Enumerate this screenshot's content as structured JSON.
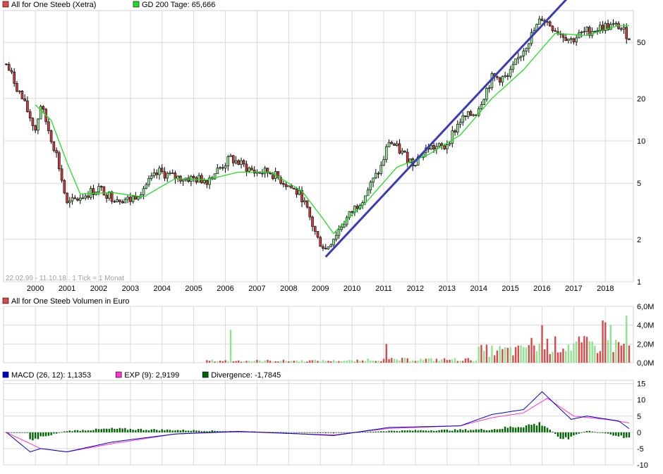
{
  "colors": {
    "up": "#8fe28f",
    "down": "#c83c3c",
    "ma": "#22dd22",
    "trend": "#3b3bb5",
    "vol_up": "#8fe28f",
    "vol_down": "#d94a4a",
    "macd": "#0000cc",
    "exp": "#ff33cc",
    "divergence": "#006400",
    "grid": "#d9d9d9"
  },
  "price_panel": {
    "legend": [
      {
        "name": "All for One Steeb (Xetra)",
        "color": "#d94a4a",
        "icon": "red-square-icon"
      },
      {
        "name": "GD 200 Tage: 65,666",
        "color": "#22dd22",
        "icon": "green-square-icon"
      }
    ],
    "footnote": "22.02.99 - 11.10.18 . 1 Tick = 1 Monat",
    "years": [
      "2000",
      "2001",
      "2002",
      "2003",
      "2004",
      "2005",
      "2006",
      "2007",
      "2008",
      "2009",
      "2010",
      "2011",
      "2012",
      "2013",
      "2014",
      "2015",
      "2016",
      "2017",
      "2018"
    ]
  },
  "volume_panel": {
    "legend": [
      {
        "name": "All for One Steeb Volumen in Euro",
        "color": "#d94a4a",
        "icon": "red-square-icon"
      }
    ]
  },
  "macd_panel": {
    "legend": [
      {
        "name": "MACD (26, 12): 1,1353",
        "color": "#0000cc",
        "icon": "blue-square-icon"
      },
      {
        "name": "EXP (9): 2,9199",
        "color": "#ff33cc",
        "icon": "magenta-square-icon"
      },
      {
        "name": "Divergence: -1,7845",
        "color": "#006400",
        "icon": "darkgreen-square-icon"
      }
    ]
  },
  "chart_data": [
    {
      "type": "candlestick",
      "title": "All for One Steeb (Xetra)",
      "scale": "log",
      "x_range": [
        "1999-02",
        "2018-10"
      ],
      "y_ticks": [
        1,
        2,
        5,
        10,
        20,
        50
      ],
      "y_tick_labels": [
        "1",
        "2",
        "5",
        "10",
        "20",
        "50"
      ],
      "ylim": [
        1,
        100
      ],
      "close_anchors": [
        {
          "x": "1999-02",
          "close": 35
        },
        {
          "x": "1999-07",
          "close": 22
        },
        {
          "x": "2000-01",
          "close": 12
        },
        {
          "x": "2000-03",
          "close": 18
        },
        {
          "x": "2000-09",
          "close": 8
        },
        {
          "x": "2001-01",
          "close": 3.5
        },
        {
          "x": "2001-06",
          "close": 4.0
        },
        {
          "x": "2002-01",
          "close": 4.6
        },
        {
          "x": "2002-06",
          "close": 4.0
        },
        {
          "x": "2003-01",
          "close": 3.8
        },
        {
          "x": "2003-12",
          "close": 6.0
        },
        {
          "x": "2004-06",
          "close": 5.5
        },
        {
          "x": "2005-06",
          "close": 5.3
        },
        {
          "x": "2006-03",
          "close": 7.5
        },
        {
          "x": "2006-12",
          "close": 6.0
        },
        {
          "x": "2007-06",
          "close": 6.0
        },
        {
          "x": "2008-01",
          "close": 4.8
        },
        {
          "x": "2008-06",
          "close": 4.0
        },
        {
          "x": "2008-12",
          "close": 2.0
        },
        {
          "x": "2009-03",
          "close": 1.7
        },
        {
          "x": "2009-09",
          "close": 2.5
        },
        {
          "x": "2010-06",
          "close": 4.2
        },
        {
          "x": "2010-12",
          "close": 6.5
        },
        {
          "x": "2011-03",
          "close": 10.0
        },
        {
          "x": "2011-12",
          "close": 7.0
        },
        {
          "x": "2012-06",
          "close": 9.0
        },
        {
          "x": "2012-12",
          "close": 9.0
        },
        {
          "x": "2013-06",
          "close": 14.0
        },
        {
          "x": "2013-12",
          "close": 16.0
        },
        {
          "x": "2014-06",
          "close": 28.0
        },
        {
          "x": "2014-12",
          "close": 28.0
        },
        {
          "x": "2015-06",
          "close": 45.0
        },
        {
          "x": "2016-01",
          "close": 75.0
        },
        {
          "x": "2016-06",
          "close": 62.0
        },
        {
          "x": "2016-12",
          "close": 52.0
        },
        {
          "x": "2017-06",
          "close": 60.0
        },
        {
          "x": "2018-01",
          "close": 65.0
        },
        {
          "x": "2018-06",
          "close": 65.0
        },
        {
          "x": "2018-10",
          "close": 55.0
        }
      ],
      "series": [
        {
          "name": "GD 200 Tage",
          "type": "line",
          "values": [
            {
              "x": "2000-01",
              "y": 18
            },
            {
              "x": "2000-07",
              "y": 14
            },
            {
              "x": "2001-01",
              "y": 7
            },
            {
              "x": "2001-06",
              "y": 4.2
            },
            {
              "x": "2002-06",
              "y": 4.3
            },
            {
              "x": "2003-06",
              "y": 4.0
            },
            {
              "x": "2004-06",
              "y": 5.4
            },
            {
              "x": "2005-06",
              "y": 5.3
            },
            {
              "x": "2006-06",
              "y": 6.0
            },
            {
              "x": "2007-06",
              "y": 6.0
            },
            {
              "x": "2008-06",
              "y": 4.4
            },
            {
              "x": "2009-02",
              "y": 2.8
            },
            {
              "x": "2009-06",
              "y": 2.2
            },
            {
              "x": "2010-01",
              "y": 3.0
            },
            {
              "x": "2010-06",
              "y": 3.6
            },
            {
              "x": "2011-06",
              "y": 6.5
            },
            {
              "x": "2012-06",
              "y": 8.0
            },
            {
              "x": "2013-06",
              "y": 11.0
            },
            {
              "x": "2014-06",
              "y": 20.0
            },
            {
              "x": "2015-06",
              "y": 32.0
            },
            {
              "x": "2016-06",
              "y": 58.0
            },
            {
              "x": "2017-06",
              "y": 56.0
            },
            {
              "x": "2018-06",
              "y": 66.0
            },
            {
              "x": "2018-10",
              "y": 65.666
            }
          ]
        },
        {
          "name": "trend",
          "type": "trendline",
          "values": [
            {
              "x": "2009-03",
              "y": 1.5
            },
            {
              "x": "2018-01",
              "y": 200
            }
          ]
        }
      ]
    },
    {
      "type": "bar",
      "title": "All for One Steeb Volumen in Euro",
      "unit": "Euro",
      "y_ticks": [
        0,
        2,
        4,
        6
      ],
      "y_tick_labels": [
        "0,0M",
        "2,0M",
        "4,0M",
        "6,0M"
      ],
      "ylim": [
        0,
        6
      ],
      "x_range": [
        "1999-02",
        "2018-10"
      ],
      "peaks_millions": [
        {
          "x": "2006-03",
          "value": 3.5
        },
        {
          "x": "2011-02",
          "value": 2.0
        },
        {
          "x": "2016-01",
          "value": 4.0
        },
        {
          "x": "2017-12",
          "value": 4.5
        },
        {
          "x": "2018-01",
          "value": 4.3
        },
        {
          "x": "2018-03",
          "value": 4.0
        },
        {
          "x": "2018-09",
          "value": 5.0
        }
      ]
    },
    {
      "type": "line",
      "title": "MACD",
      "y_ticks": [
        -10,
        -5,
        0,
        5,
        10,
        15
      ],
      "ylim": [
        -10,
        16
      ],
      "x_range": [
        "1999-02",
        "2018-10"
      ],
      "series": [
        {
          "name": "MACD (26, 12)",
          "last": 1.1353,
          "values": [
            {
              "x": "1999-02",
              "y": 0
            },
            {
              "x": "1999-11",
              "y": -6
            },
            {
              "x": "2000-03",
              "y": -5
            },
            {
              "x": "2001-01",
              "y": -6
            },
            {
              "x": "2002-06",
              "y": -3
            },
            {
              "x": "2004-06",
              "y": -0.5
            },
            {
              "x": "2006-06",
              "y": 0.3
            },
            {
              "x": "2008-06",
              "y": -0.5
            },
            {
              "x": "2009-06",
              "y": -1
            },
            {
              "x": "2011-03",
              "y": 1.5
            },
            {
              "x": "2013-06",
              "y": 2
            },
            {
              "x": "2014-06",
              "y": 5.5
            },
            {
              "x": "2015-06",
              "y": 7
            },
            {
              "x": "2016-01",
              "y": 12.5
            },
            {
              "x": "2016-12",
              "y": 4
            },
            {
              "x": "2017-06",
              "y": 5
            },
            {
              "x": "2018-06",
              "y": 3.5
            },
            {
              "x": "2018-10",
              "y": 1.1353
            }
          ]
        },
        {
          "name": "EXP (9)",
          "last": 2.9199,
          "values": [
            {
              "x": "1999-02",
              "y": 0
            },
            {
              "x": "2000-03",
              "y": -5
            },
            {
              "x": "2001-01",
              "y": -6
            },
            {
              "x": "2002-06",
              "y": -3.5
            },
            {
              "x": "2004-06",
              "y": -0.5
            },
            {
              "x": "2006-06",
              "y": 0.2
            },
            {
              "x": "2009-06",
              "y": -0.8
            },
            {
              "x": "2011-03",
              "y": 1.2
            },
            {
              "x": "2013-06",
              "y": 2
            },
            {
              "x": "2014-06",
              "y": 4.5
            },
            {
              "x": "2015-06",
              "y": 6
            },
            {
              "x": "2016-03",
              "y": 10.5
            },
            {
              "x": "2017-01",
              "y": 5
            },
            {
              "x": "2018-01",
              "y": 4
            },
            {
              "x": "2018-10",
              "y": 2.9199
            }
          ]
        },
        {
          "name": "Divergence",
          "type": "bar",
          "last": -1.7845,
          "values": [
            {
              "x": "1999-11",
              "y": -2.5
            },
            {
              "x": "2001-01",
              "y": 0.5
            },
            {
              "x": "2002-06",
              "y": 1.2
            },
            {
              "x": "2009-06",
              "y": -0.3
            },
            {
              "x": "2011-03",
              "y": 0.5
            },
            {
              "x": "2014-06",
              "y": 1
            },
            {
              "x": "2016-01",
              "y": 3
            },
            {
              "x": "2016-09",
              "y": -2.5
            },
            {
              "x": "2017-06",
              "y": 0.6
            },
            {
              "x": "2018-10",
              "y": -1.7845
            }
          ]
        }
      ]
    }
  ]
}
